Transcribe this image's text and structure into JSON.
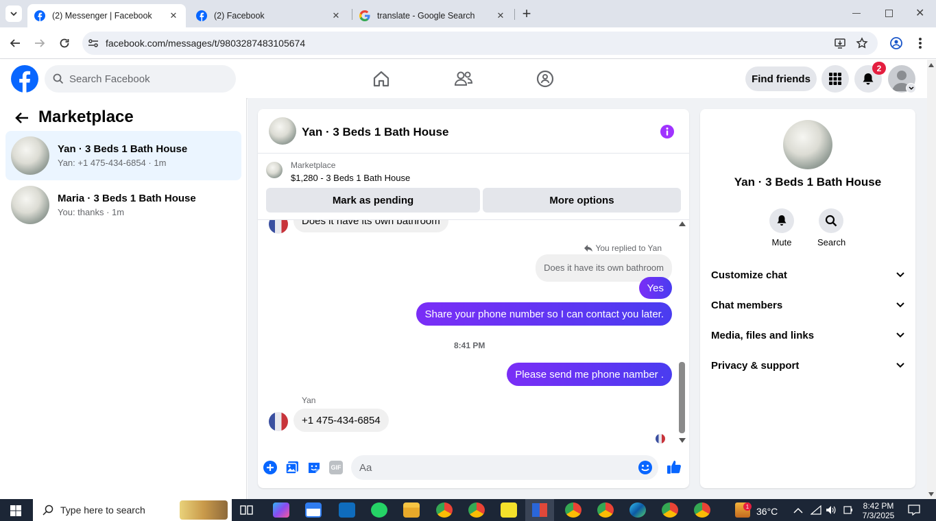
{
  "browser": {
    "tabs": [
      {
        "title": "(2) Messenger | Facebook",
        "active": true
      },
      {
        "title": "(2) Facebook",
        "active": false
      },
      {
        "title": "translate - Google Search",
        "active": false
      }
    ],
    "url": "facebook.com/messages/t/9803287483105674"
  },
  "fb_header": {
    "search_placeholder": "Search Facebook",
    "find_friends_label": "Find friends",
    "notification_count": "2"
  },
  "left_pane": {
    "title": "Marketplace",
    "conversations": [
      {
        "name": "Yan · 3 Beds 1 Bath House",
        "preview": "Yan: +1 475-434-6854 · 1m",
        "selected": true
      },
      {
        "name": "Maria · 3 Beds 1 Bath House",
        "preview": "You: thanks · 1m",
        "selected": false
      }
    ]
  },
  "chat": {
    "title": "Yan · 3 Beds 1 Bath House",
    "listing_source": "Marketplace",
    "listing_line": "$1,280 - 3 Beds 1 Bath House",
    "mark_pending_label": "Mark as pending",
    "more_options_label": "More options",
    "messages": {
      "partial_incoming": "Does it have its own bathroom",
      "reply_note": "You replied to Yan",
      "quoted": "Does it have its own bathroom",
      "out_yes": "Yes",
      "out_share": "Share your phone number so I can contact you later.",
      "timestamp": "8:41 PM",
      "out_please": "Please send me phone namber .",
      "sender_name": "Yan",
      "incoming_phone": "+1 475-434-6854"
    },
    "composer_placeholder": "Aa",
    "composer_gif_label": "GIF"
  },
  "right_pane": {
    "title": "Yan · 3 Beds 1 Bath House",
    "mute_label": "Mute",
    "search_label": "Search",
    "sections": [
      "Customize chat",
      "Chat members",
      "Media, files and links",
      "Privacy & support"
    ]
  },
  "taskbar": {
    "search_placeholder": "Type here to search",
    "temperature": "36°C",
    "time": "8:42 PM",
    "date": "7/3/2025",
    "notif_badge": "1"
  },
  "colors": {
    "fb_blue": "#0866ff",
    "messenger_purple": "#a033ff",
    "out_bubble": "#5b2ff5",
    "notification_red": "#e41e3f"
  }
}
